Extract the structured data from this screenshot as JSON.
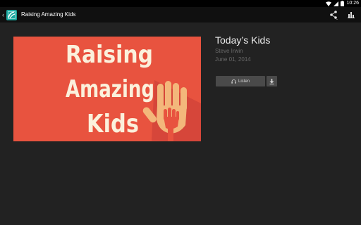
{
  "status": {
    "time": "10:26"
  },
  "action_bar": {
    "title": "Raising Amazing Kids"
  },
  "cover": {
    "line1": "Raising",
    "line2": "Amazing",
    "line3": "Kids"
  },
  "episode": {
    "title": "Today’s Kids",
    "author": "Steve Irwin",
    "date": "June 01, 2014"
  },
  "actions": {
    "listen_label": "Listen"
  },
  "icons": {
    "back": "back-chevron-icon",
    "logo": "app-logo-icon",
    "share": "share-icon",
    "chart": "bar-chart-icon",
    "headphones": "headphones-icon",
    "download": "download-icon",
    "wifi": "wifi-icon",
    "signal": "signal-icon",
    "battery": "battery-icon"
  },
  "colors": {
    "background": "#222222",
    "action_bar": "#101010",
    "cover_red": "#e8533f",
    "cover_cream": "#fbf1dc",
    "hand_orange": "#f3b77b",
    "logo_teal": "#1aa79e"
  }
}
